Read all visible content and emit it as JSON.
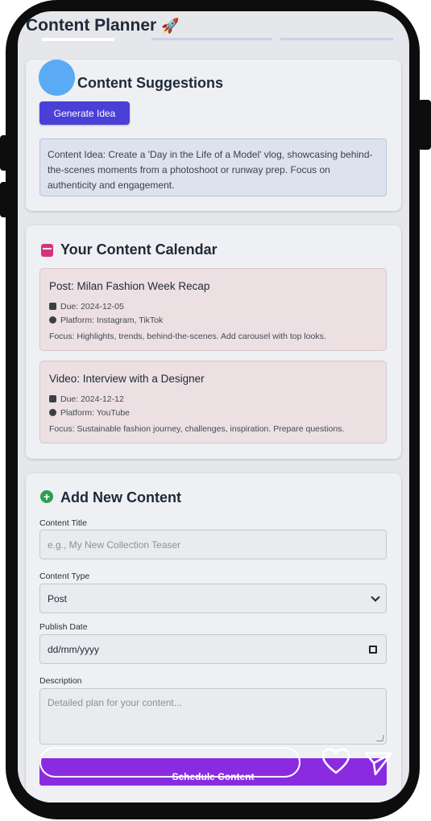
{
  "app": {
    "title": "Content Planner",
    "title_emoji": "🚀"
  },
  "suggestions": {
    "heading": "Content Suggestions",
    "generate_label": "Generate Idea",
    "idea_text": "Content Idea: Create a 'Day in the Life of a Model' vlog, showcasing behind-the-scenes moments from a photoshoot or runway prep. Focus on authenticity and engagement."
  },
  "calendar": {
    "heading": "Your Content Calendar",
    "items": [
      {
        "title": "Post: Milan Fashion Week Recap",
        "due": "Due: 2024-12-05",
        "platform": "Platform: Instagram, TikTok",
        "focus": "Focus: Highlights, trends, behind-the-scenes. Add carousel with top looks."
      },
      {
        "title": "Video: Interview with a Designer",
        "due": "Due: 2024-12-12",
        "platform": "Platform: YouTube",
        "focus": "Focus: Sustainable fashion journey, challenges, inspiration. Prepare questions."
      }
    ]
  },
  "add_content": {
    "heading": "Add New Content",
    "title_label": "Content Title",
    "title_placeholder": "e.g., My New Collection Teaser",
    "type_label": "Content Type",
    "type_value": "Post",
    "date_label": "Publish Date",
    "date_value": "dd/mm/yyyy",
    "description_label": "Description",
    "description_placeholder": "Detailed plan for your content...",
    "submit_label": "Schedule Content"
  },
  "colors": {
    "primary_button": "#4a3fd6",
    "schedule_button": "#8a2be2",
    "calendar_icon": "#d6337e",
    "add_icon": "#2f9e52",
    "event_card": "#ece0e3",
    "idea_box": "#dde2ef"
  },
  "icons": [
    "rocket-icon",
    "calendar-icon",
    "plus-circle-icon",
    "heart-icon",
    "send-icon"
  ]
}
